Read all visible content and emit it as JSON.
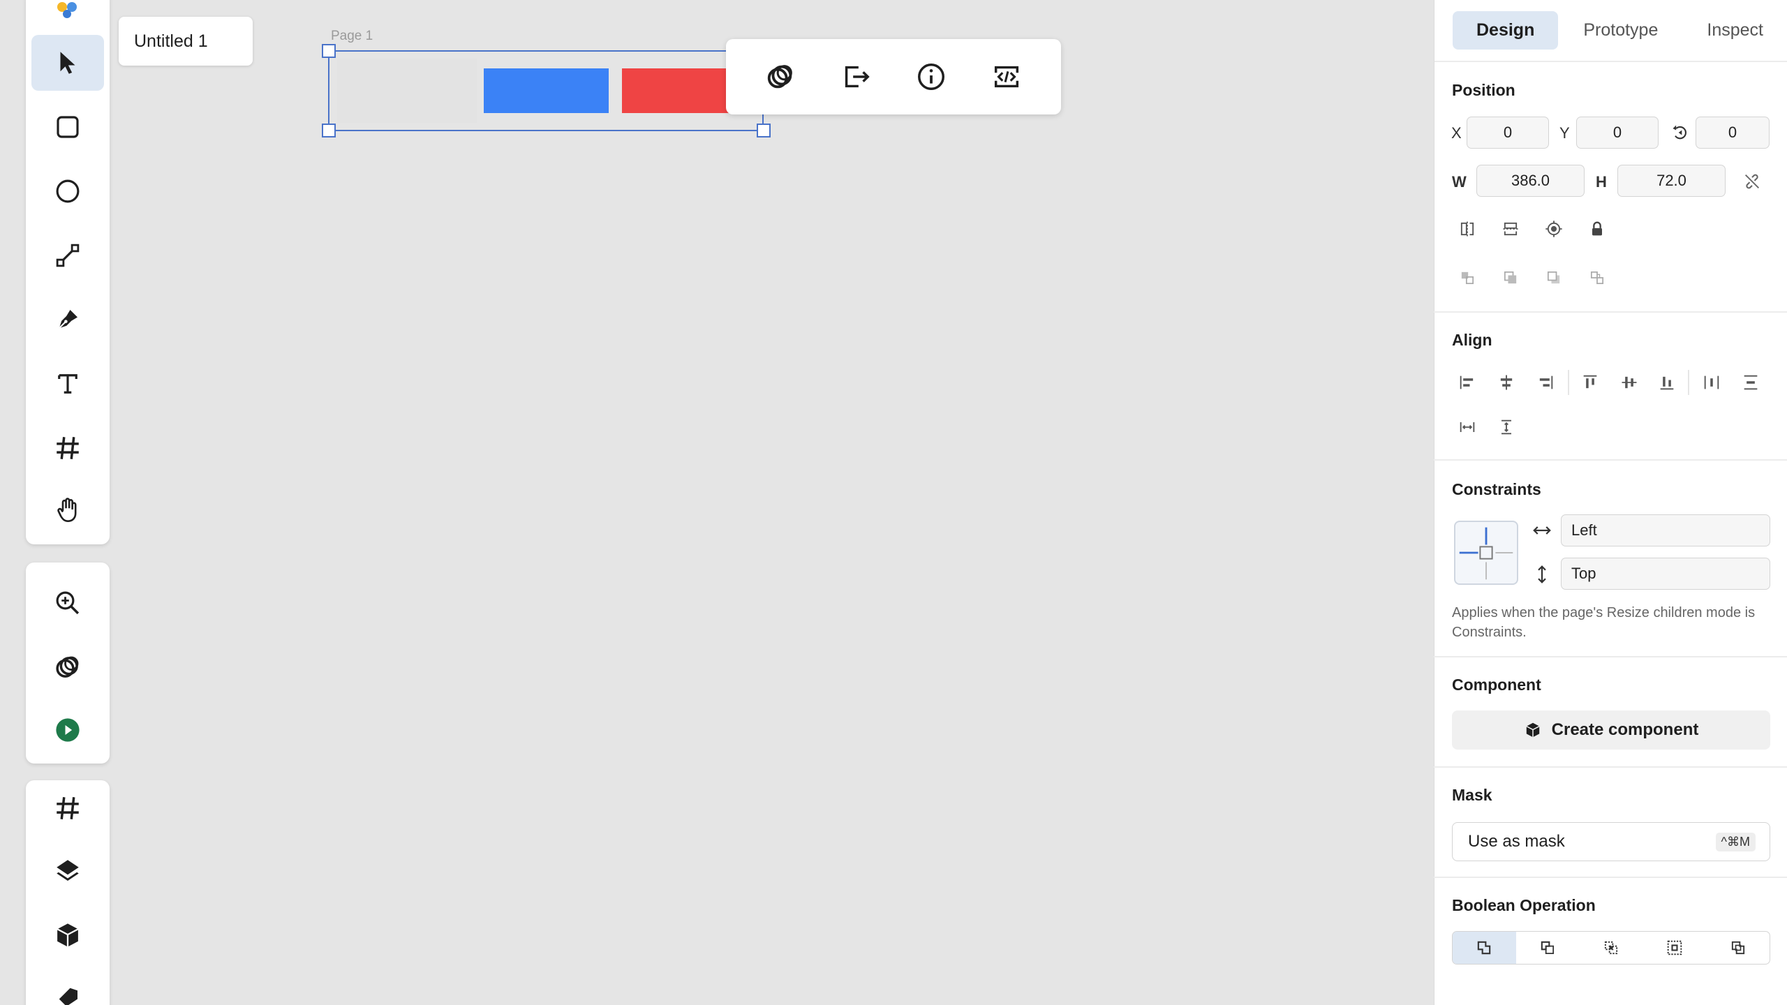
{
  "file_tab": {
    "title": "Untitled 1"
  },
  "canvas": {
    "page_label": "Page 1"
  },
  "right_panel": {
    "tabs": [
      {
        "label": "Design",
        "active": true
      },
      {
        "label": "Prototype",
        "active": false
      },
      {
        "label": "Inspect",
        "active": false
      }
    ],
    "position": {
      "title": "Position",
      "x_label": "X",
      "x": "0",
      "y_label": "Y",
      "y": "0",
      "rotation": "0",
      "w_label": "W",
      "w": "386.0",
      "h_label": "H",
      "h": "72.0"
    },
    "align": {
      "title": "Align"
    },
    "constraints": {
      "title": "Constraints",
      "horizontal": "Left",
      "vertical": "Top",
      "note": "Applies when the page's Resize children mode is Constraints."
    },
    "component": {
      "title": "Component",
      "create_label": "Create component"
    },
    "mask": {
      "title": "Mask",
      "use_label": "Use as mask",
      "shortcut": "^⌘M"
    },
    "boolean": {
      "title": "Boolean Operation"
    }
  },
  "colors": {
    "accent": "#4a73c9",
    "shape_blue": "#3b82f6",
    "shape_red": "#ef4444",
    "active_bg": "#dde7f3",
    "play_green": "#1e7a4a"
  }
}
